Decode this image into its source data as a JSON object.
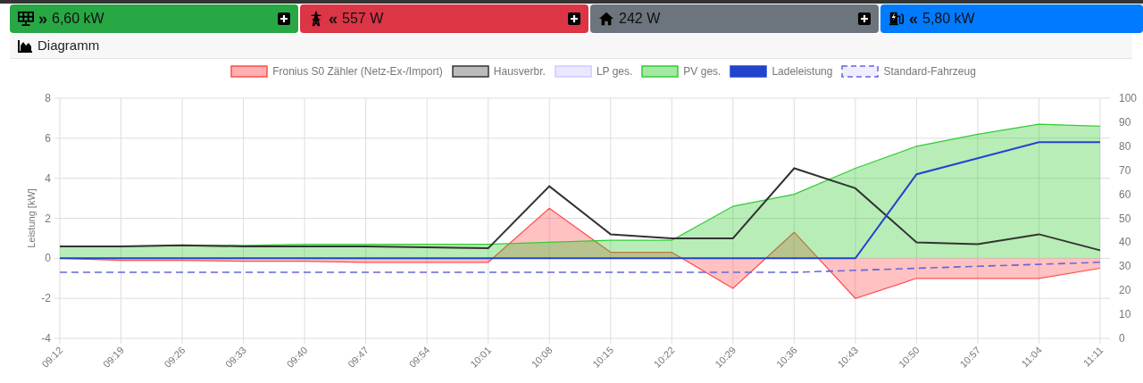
{
  "tiles": [
    {
      "kind": "solar",
      "color": "#28a745",
      "arrow": "»",
      "value": "6,60 kW",
      "expandable": true
    },
    {
      "kind": "grid",
      "color": "#dc3545",
      "arrow": "«",
      "value": "557 W",
      "expandable": true
    },
    {
      "kind": "house",
      "color": "#6c757d",
      "value": "242 W",
      "expandable": true
    },
    {
      "kind": "charger",
      "color": "#007bff",
      "arrow": "«",
      "value": "5,80 kW",
      "expandable": false
    }
  ],
  "panel": {
    "title": "Diagramm",
    "chart_data": {
      "type": "area",
      "grid": true,
      "ylabel": "Leistung [kW]",
      "categories": [
        "09:12",
        "09:19",
        "09:26",
        "09:33",
        "09:40",
        "09:47",
        "09:54",
        "10:01",
        "10:08",
        "10:15",
        "10:22",
        "10:29",
        "10:36",
        "10:43",
        "10:50",
        "10:57",
        "11:04",
        "11:11"
      ],
      "ylim": [
        -4,
        8
      ],
      "yticks": [
        -4,
        -2,
        0,
        2,
        4,
        6,
        8
      ],
      "y2lim": [
        0,
        100
      ],
      "y2ticks": [
        0,
        10,
        20,
        30,
        40,
        50,
        60,
        70,
        80,
        90,
        100
      ],
      "series": [
        {
          "name": "Fronius S0 Zähler (Netz-Ex-/Import)",
          "type": "area",
          "color": "#ff4d4d",
          "values": [
            0,
            -0.1,
            -0.1,
            -0.15,
            -0.15,
            -0.2,
            -0.2,
            -0.2,
            2.5,
            0.3,
            0.3,
            -1.5,
            1.3,
            -2.0,
            -1.0,
            -1.0,
            -1.0,
            -0.5
          ]
        },
        {
          "name": "Hausverbr.",
          "type": "line",
          "color": "#333333",
          "values": [
            0.6,
            0.6,
            0.65,
            0.6,
            0.6,
            0.6,
            0.55,
            0.5,
            3.6,
            1.2,
            1.0,
            1.0,
            4.5,
            3.5,
            0.8,
            0.7,
            1.2,
            0.4
          ]
        },
        {
          "name": "LP ges.",
          "type": "area",
          "color": "#ccccff",
          "values": [
            null,
            null,
            null,
            null,
            null,
            null,
            null,
            null,
            null,
            null,
            null,
            null,
            null,
            null,
            null,
            null,
            null,
            null
          ]
        },
        {
          "name": "PV ges.",
          "type": "area",
          "color": "#33cc33",
          "values": [
            0.6,
            0.6,
            0.65,
            0.65,
            0.7,
            0.7,
            0.7,
            0.7,
            0.8,
            0.9,
            0.9,
            2.6,
            3.2,
            4.5,
            5.6,
            6.2,
            6.7,
            6.6
          ]
        },
        {
          "name": "Ladeleistung",
          "type": "line",
          "color": "#2244cc",
          "values": [
            0,
            0,
            0,
            0,
            0,
            0,
            0,
            0,
            0,
            0,
            0,
            0,
            0,
            0,
            4.2,
            5.0,
            5.8,
            5.8
          ]
        },
        {
          "name": "Standard-Fahrzeug",
          "type": "line",
          "line_style": "dashed",
          "color": "#6666dd",
          "values": [
            -0.7,
            -0.7,
            -0.7,
            -0.7,
            -0.7,
            -0.7,
            -0.7,
            -0.7,
            -0.7,
            -0.7,
            -0.7,
            -0.7,
            -0.7,
            -0.6,
            -0.5,
            -0.4,
            -0.3,
            -0.2
          ]
        }
      ]
    }
  }
}
